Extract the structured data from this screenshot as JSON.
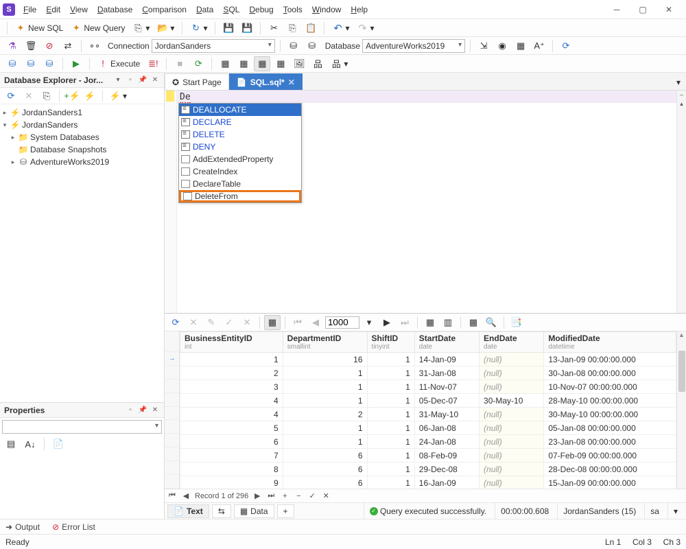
{
  "menu": [
    "File",
    "Edit",
    "View",
    "Database",
    "Comparison",
    "Data",
    "SQL",
    "Debug",
    "Tools",
    "Window",
    "Help"
  ],
  "toolbar1": {
    "newsql": "New SQL",
    "newquery": "New Query"
  },
  "toolbar2": {
    "conn_label": "Connection",
    "conn_value": "JordanSanders",
    "db_label": "Database",
    "db_value": "AdventureWorks2019"
  },
  "toolbar3": {
    "execute": "Execute"
  },
  "explorer": {
    "title": "Database Explorer - Jor...",
    "nodes": {
      "srv1": "JordanSanders1",
      "srv2": "JordanSanders",
      "sysdb": "System Databases",
      "snap": "Database Snapshots",
      "adv": "AdventureWorks2019"
    }
  },
  "properties": {
    "title": "Properties"
  },
  "tabs": {
    "start": "Start Page",
    "sql": "SQL.sql*"
  },
  "editor": {
    "typed": "De"
  },
  "intellisense": {
    "items": [
      {
        "txt": "DEALLOCATE",
        "kind": "kw",
        "sel": true
      },
      {
        "txt": "DECLARE",
        "kind": "kw"
      },
      {
        "txt": "DELETE",
        "kind": "kw"
      },
      {
        "txt": "DENY",
        "kind": "kw"
      },
      {
        "txt": "AddExtendedProperty",
        "kind": "snip"
      },
      {
        "txt": "CreateIndex",
        "kind": "snip"
      },
      {
        "txt": "DeclareTable",
        "kind": "snip"
      },
      {
        "txt": "DeleteFrom",
        "kind": "snip",
        "highlight": true
      }
    ]
  },
  "results": {
    "pager_value": "1000",
    "columns": [
      {
        "name": "BusinessEntityID",
        "type": "int"
      },
      {
        "name": "DepartmentID",
        "type": "smallint"
      },
      {
        "name": "ShiftID",
        "type": "tinyint"
      },
      {
        "name": "StartDate",
        "type": "date"
      },
      {
        "name": "EndDate",
        "type": "date"
      },
      {
        "name": "ModifiedDate",
        "type": "datetime"
      }
    ],
    "rows": [
      [
        "1",
        "16",
        "1",
        "14-Jan-09",
        "(null)",
        "13-Jan-09 00:00:00.000"
      ],
      [
        "2",
        "1",
        "1",
        "31-Jan-08",
        "(null)",
        "30-Jan-08 00:00:00.000"
      ],
      [
        "3",
        "1",
        "1",
        "11-Nov-07",
        "(null)",
        "10-Nov-07 00:00:00.000"
      ],
      [
        "4",
        "1",
        "1",
        "05-Dec-07",
        "30-May-10",
        "28-May-10 00:00:00.000"
      ],
      [
        "4",
        "2",
        "1",
        "31-May-10",
        "(null)",
        "30-May-10 00:00:00.000"
      ],
      [
        "5",
        "1",
        "1",
        "06-Jan-08",
        "(null)",
        "05-Jan-08 00:00:00.000"
      ],
      [
        "6",
        "1",
        "1",
        "24-Jan-08",
        "(null)",
        "23-Jan-08 00:00:00.000"
      ],
      [
        "7",
        "6",
        "1",
        "08-Feb-09",
        "(null)",
        "07-Feb-09 00:00:00.000"
      ],
      [
        "8",
        "6",
        "1",
        "29-Dec-08",
        "(null)",
        "28-Dec-08 00:00:00.000"
      ],
      [
        "9",
        "6",
        "1",
        "16-Jan-09",
        "(null)",
        "15-Jan-09 00:00:00.000"
      ]
    ],
    "record_nav": "Record 1 of 296",
    "tabs": {
      "text": "Text",
      "data": "Data"
    },
    "status_msg": "Query executed successfully.",
    "status_time": "00:00:00.608",
    "status_conn": "JordanSanders (15)",
    "status_user": "sa"
  },
  "bottom": {
    "output": "Output",
    "errors": "Error List"
  },
  "statusbar": {
    "ready": "Ready",
    "pos": "Ln 1     Col 3     Ch 3"
  }
}
